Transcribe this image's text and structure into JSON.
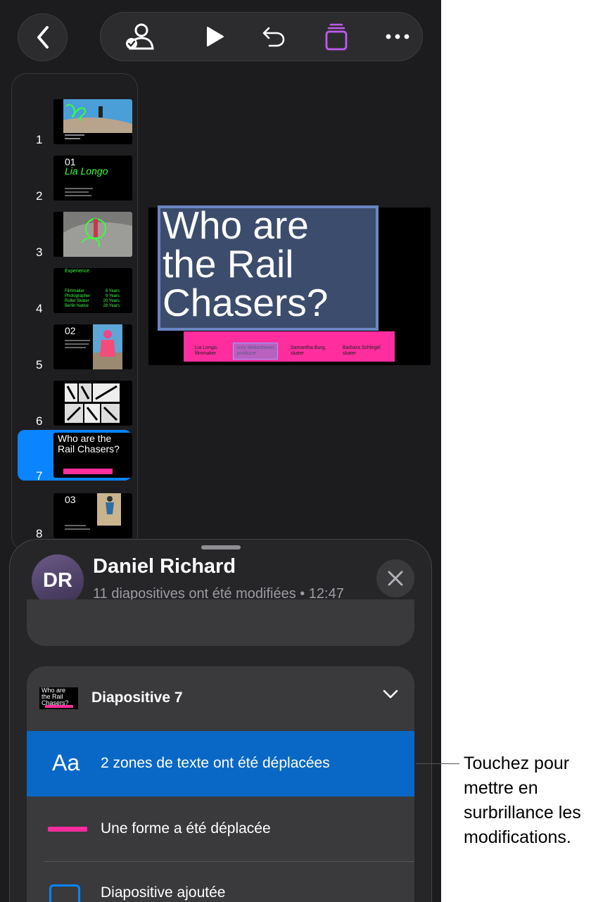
{
  "toolbar": {
    "back": "chevron-left-icon",
    "collaborate": "person-check-icon",
    "play": "play-icon",
    "undo": "undo-icon",
    "format": "document-icon",
    "more": "more-icon",
    "accent": "#bf5af2"
  },
  "navigator": {
    "selected_index": 7,
    "slides": [
      {
        "num": "1"
      },
      {
        "num": "2",
        "big": "01",
        "name": "Lia Longo"
      },
      {
        "num": "3"
      },
      {
        "num": "4",
        "heading": "Experience",
        "rows": [
          [
            "Filmmaker",
            "6 Years"
          ],
          [
            "Photographer",
            "9 Years"
          ],
          [
            "Roller Skater",
            "20 Years"
          ],
          [
            "Berlin Native",
            "28 Years"
          ]
        ]
      },
      {
        "num": "5",
        "big": "02"
      },
      {
        "num": "6"
      },
      {
        "num": "7",
        "title": "Who are the Rail Chasers?"
      },
      {
        "num": "8",
        "big": "03"
      }
    ]
  },
  "slide": {
    "title_lines": [
      "Who are",
      "the Rail",
      "Chasers?"
    ],
    "people": [
      {
        "name": "Lia Longo,",
        "role": "filmmaker"
      },
      {
        "name": "Izzy Weberbauer,",
        "role": "producer"
      },
      {
        "name": "Samantha Burg,",
        "role": "skater"
      },
      {
        "name": "Barbara Schlegel",
        "role": "skater"
      }
    ],
    "accent": "#ff2d9e"
  },
  "sheet": {
    "avatar_initials": "DR",
    "user_name": "Daniel Richard",
    "subtitle": "11 diapositives ont été modifiées • 12:47",
    "card": {
      "thumb_lines": [
        "Who are",
        "the Rail",
        "Chasers?"
      ],
      "title": "Diapositive 7",
      "rows": [
        {
          "icon": "Aa",
          "label": "2 zones de texte ont été déplacées"
        },
        {
          "icon": "shape-line-icon",
          "label": "Une forme a été déplacée"
        },
        {
          "icon": "slide-added-icon",
          "label": "Diapositive ajoutée"
        }
      ]
    }
  },
  "callout": {
    "lines": [
      "Touchez pour",
      "mettre en",
      "surbrillance les",
      "modifications."
    ]
  }
}
